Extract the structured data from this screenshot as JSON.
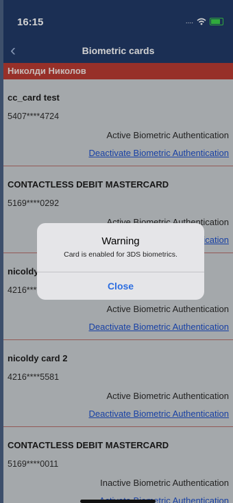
{
  "status_bar": {
    "time": "16:15",
    "signal": "....",
    "wifi_icon": "wifi-icon",
    "battery_icon": "battery-charging-icon"
  },
  "header": {
    "back_icon": "chevron-left-icon",
    "title": "Biometric cards"
  },
  "owner": {
    "name": "Николди Николов"
  },
  "cards": [
    {
      "name": "cc_card test",
      "pan": "5407****4724",
      "status": "Active Biometric Authentication",
      "action": "Deactivate Biometric Authentication"
    },
    {
      "name": "CONTACTLESS DEBIT MASTERCARD",
      "pan": "5169****0292",
      "status": "Active Biometric Authentication",
      "action": "Deactivate Biometric Authentication"
    },
    {
      "name": "nicoldy card 1",
      "pan": "4216****5581",
      "status": "Active Biometric Authentication",
      "action": "Deactivate Biometric Authentication"
    },
    {
      "name": "nicoldy card 2",
      "pan": "4216****5581",
      "status": "Active Biometric Authentication",
      "action": "Deactivate Biometric Authentication"
    },
    {
      "name": "CONTACTLESS DEBIT MASTERCARD",
      "pan": "5169****0011",
      "status": "Inactive Biometric Authentication",
      "action": "Activate Biometric Authentication"
    }
  ],
  "dialog": {
    "title": "Warning",
    "message": "Card is enabled for 3DS biometrics.",
    "button": "Close"
  },
  "colors": {
    "nav": "#213a67",
    "owner_bar": "#b93b32",
    "link": "#1d4fc9",
    "dialog_button": "#2c6de0"
  }
}
